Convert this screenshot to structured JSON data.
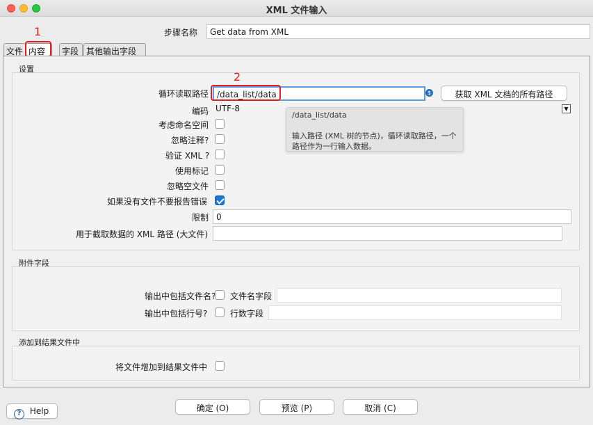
{
  "window": {
    "title": "XML 文件输入"
  },
  "step": {
    "label": "步骤名称",
    "value": "Get data from XML"
  },
  "tabs": [
    "文件",
    "内容",
    "字段",
    "其他输出字段"
  ],
  "annotations": {
    "one": "1",
    "two": "2"
  },
  "settings": {
    "title": "设置",
    "loop_path_label": "循环读取路径",
    "loop_path_value": "/data_list/data",
    "get_paths_button": "获取 XML 文档的所有路径",
    "encoding_label": "编码",
    "encoding_value": "UTF-8",
    "namespace_label": "考虑命名空间",
    "ignore_comments_label": "忽略注释?",
    "validate_label": "验证 XML ?",
    "use_token_label": "使用标记",
    "ignore_empty_label": "忽略空文件",
    "no_file_error_label": "如果没有文件不要报告错误",
    "limit_label": "限制",
    "limit_value": "0",
    "prune_path_label": "用于截取数据的 XML 路径 (大文件)",
    "prune_path_value": ""
  },
  "tooltip": {
    "path": "/data_list/data",
    "line1": "输入路径 (XML 树的节点)，循环读取路径，一个",
    "line2": "路径作为一行输入数据。"
  },
  "additional": {
    "title": "附件字段",
    "include_filename_label": "输出中包括文件名?",
    "filename_field_label": "文件名字段",
    "include_rownum_label": "输出中包括行号?",
    "rownum_field_label": "行数字段"
  },
  "result": {
    "title": "添加到结果文件中",
    "add_to_result_label": "将文件增加到结果文件中"
  },
  "buttons": {
    "help": "Help",
    "ok": "确定 (O)",
    "preview": "预览 (P)",
    "cancel": "取消 (C)"
  },
  "colors": {
    "annotation": "#e02020",
    "checkbox_checked": "#1976d2"
  }
}
